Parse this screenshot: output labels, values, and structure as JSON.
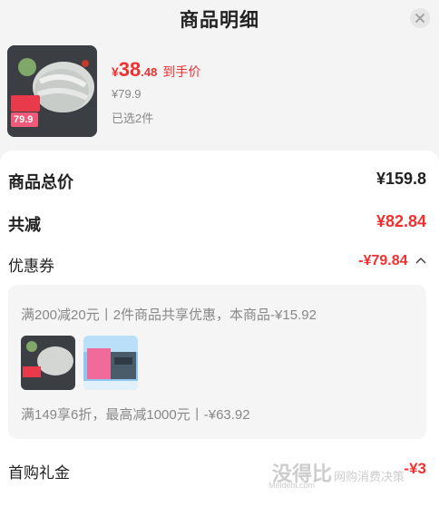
{
  "header": {
    "title": "商品明细"
  },
  "product": {
    "price_symbol": "¥",
    "price_int": "38",
    "price_dec": ".48",
    "price_tag": "到手价",
    "original_price": "¥79.9",
    "selected_count": "已选2件",
    "thumb_badge": "79.9"
  },
  "summary": {
    "total_label": "商品总价",
    "total_value": "¥159.8",
    "reduce_label": "共减",
    "reduce_value": "¥82.84",
    "coupon_label": "优惠券",
    "coupon_value": "-¥79.84",
    "first_gift_label": "首购礼金",
    "first_gift_value": "-¥3"
  },
  "promo": {
    "line1": "满200减20元丨2件商品共享优惠，本商品-¥15.92",
    "line2": "满149享6折，最高减1000元丨-¥63.92"
  },
  "watermark": {
    "brand": "没得比",
    "slogan": "网购消费决策",
    "site": "Meidebi.com"
  },
  "colors": {
    "accent_red": "#f23030",
    "card_bg": "#ffffff",
    "page_bg": "#f4f4f4"
  }
}
